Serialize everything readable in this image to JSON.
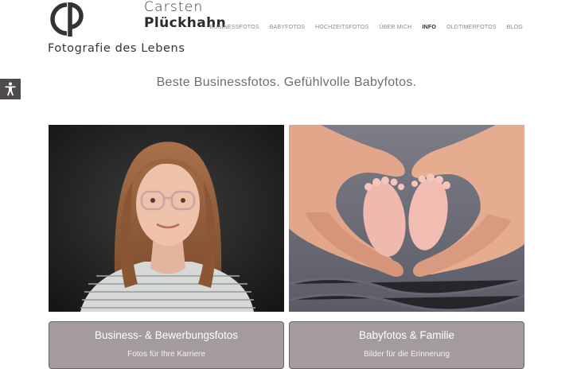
{
  "logo": {
    "first_name": "Carsten",
    "last_name": "Plückhahn",
    "tagline": "Fotografie des Lebens",
    "mark_icon": "cp-monogram-icon"
  },
  "nav": {
    "items": [
      {
        "label": "BUSINESSFOTOS",
        "active": false
      },
      {
        "label": "BABYFOTOS",
        "active": false
      },
      {
        "label": "HOCHZEITSFOTOS",
        "active": false
      },
      {
        "label": "ÜBER MICH",
        "active": false
      },
      {
        "label": "INFO",
        "active": true
      },
      {
        "label": "OLDTIMERFOTOS",
        "active": false
      },
      {
        "label": "BLOG",
        "active": false
      }
    ]
  },
  "accessibility": {
    "icon": "accessibility-icon",
    "color": "#4e4a4e"
  },
  "headline": "Beste Businessfotos. Gefühlvolle Babyfotos.",
  "cards": [
    {
      "title": "Business- & Bewerbungsfotos",
      "subtitle": "Fotos für Ihre Karriere",
      "image": "portrait-woman-glasses"
    },
    {
      "title": "Babyfotos & Familie",
      "subtitle": "Bilder für die Erinnerung",
      "image": "baby-feet-heart-hands"
    }
  ],
  "colors": {
    "caption_bg": "#a39b9f",
    "active_nav": "#2a2a2a",
    "nav": "#8a8a8a"
  }
}
